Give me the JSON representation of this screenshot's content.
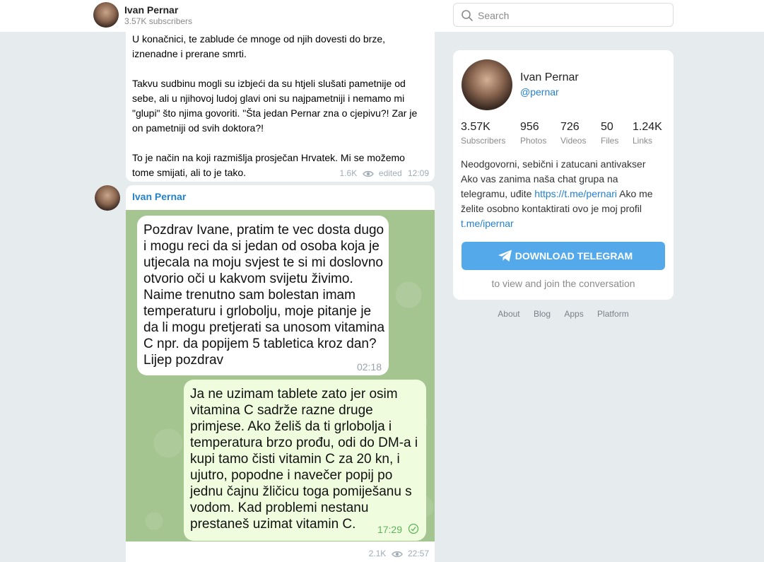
{
  "header": {
    "channel_name": "Ivan Pernar",
    "subscribers": "3.57K subscribers",
    "search_placeholder": "Search"
  },
  "messages": [
    {
      "paragraphs": [
        "U konačnici, te zablude će mnoge od njih dovesti do brze, iznenadne i prerane smrti.",
        "Takvu sudbinu mogli su izbjeći da su htjeli slušati pametnije od sebe, ali u njihovoj ludoj glavi oni su najpametniji i nemamo mi \"glupi\" što njima govoriti. \"Šta jedan Pernar zna o cjepivu?! Zar je on pametniji od svih doktora?!",
        "To je način na koji razmišlja prosječan Hrvatek. Mi se možemo tome smijati, ali to je tako."
      ],
      "views": "1.6K",
      "edited": "edited",
      "time": "12:09"
    },
    {
      "author": "Ivan Pernar",
      "photo": {
        "incoming_text": "Pozdrav Ivane, pratim te vec dosta dugo i mogu reci da si jedan od osoba koja je utjecala na moju svjest te si mi doslovno otvorio oči u kakvom svijetu živimo. Naime trenutno sam bolestan imam temperaturu i grlobolju, moje pitanje je da li mogu pretjerati sa unosom vitamina C npr. da popijem 5 tabletica kroz dan? Lijep pozdrav",
        "incoming_time": "02:18",
        "outgoing_text": "Ja ne uzimam tablete zato jer osim vitamina C sadrže razne druge primjese. Ako želiš da ti grlobolja i temperatura brzo prođu, odi do DM-a i kupi tamo čisti vitamin C za 20 kn, i ujutro, popodne i navečer popij po jednu čajnu žličicu toga pomiješanu s vodom. Kad problemi nestanu prestaneš uzimat vitamin C.",
        "outgoing_time": "17:29"
      },
      "views": "2.1K",
      "time": "22:57"
    }
  ],
  "sidebar": {
    "name": "Ivan Pernar",
    "handle": "@pernar",
    "stats": [
      {
        "value": "3.57K",
        "label": "Subscribers"
      },
      {
        "value": "956",
        "label": "Photos"
      },
      {
        "value": "726",
        "label": "Videos"
      },
      {
        "value": "50",
        "label": "Files"
      },
      {
        "value": "1.24K",
        "label": "Links"
      }
    ],
    "bio_line1": "Neodgovorni, sebični i zatucani antivakser",
    "bio_line2_pre": "Ako vas zanima naša chat grupa na telegramu, uđite ",
    "bio_link1": "https://t.me/pernari",
    "bio_line2_post": " Ako me želite osobno kontaktirati ovo je moj profil ",
    "bio_link2": "t.me/ipernar",
    "download_button": "DOWNLOAD TELEGRAM",
    "to_view": "to view and join the conversation",
    "footer_links": [
      "About",
      "Blog",
      "Apps",
      "Platform"
    ]
  },
  "colors": {
    "accent": "#2481cc",
    "button": "#54a9eb",
    "background": "#e6ebee",
    "outgoing_bubble": "#effdde"
  }
}
